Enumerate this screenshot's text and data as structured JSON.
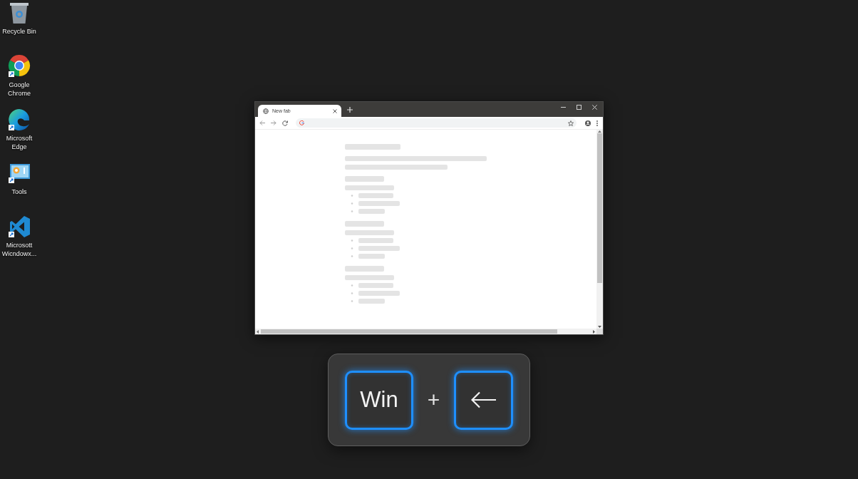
{
  "desktop_shortcuts": [
    {
      "kind": "recycle_bin",
      "label": "Recycle Bin"
    },
    {
      "kind": "chrome",
      "label": "Google Chrome"
    },
    {
      "kind": "edge",
      "label": "Microsoft Edge"
    },
    {
      "kind": "tools",
      "label": "Tools"
    },
    {
      "kind": "vscode",
      "label": "Microsott Wicndowx..."
    }
  ],
  "browser": {
    "tabs": [
      {
        "title": "New fab",
        "selected": true
      }
    ]
  },
  "key_combo": {
    "keys": [
      {
        "kind": "text",
        "label": "Win"
      },
      {
        "kind": "left_arrow"
      }
    ],
    "separator": "+"
  }
}
